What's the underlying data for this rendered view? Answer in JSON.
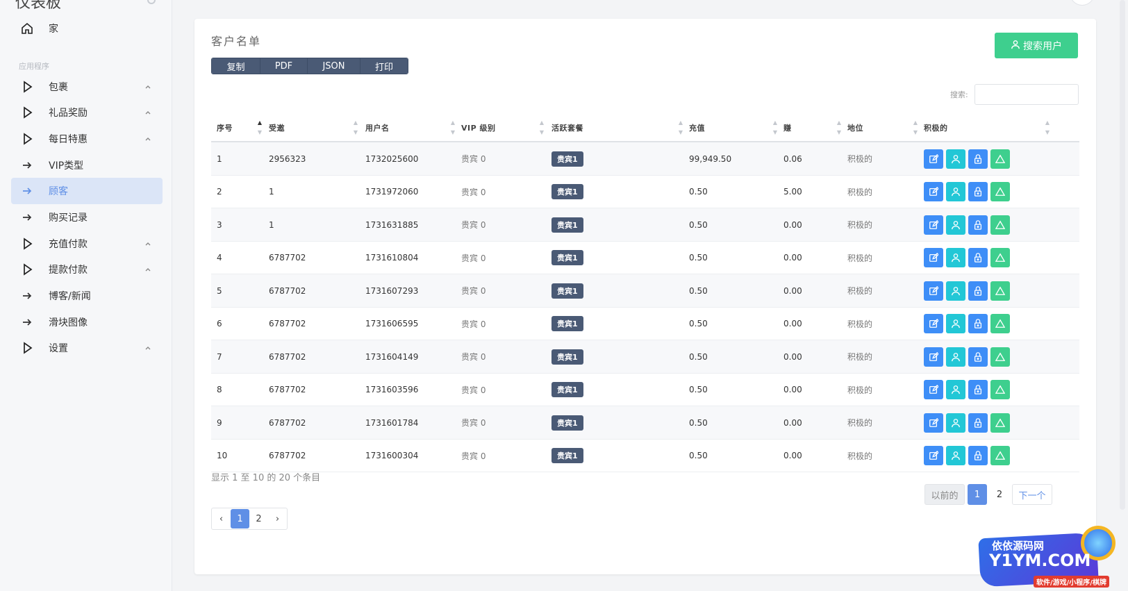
{
  "sidebar": {
    "brand": "仪表板",
    "section_label": "应用程序",
    "items": [
      {
        "label": "家",
        "icon": "home-icon",
        "has_chevron": false
      },
      {
        "label": "包裹",
        "icon": "play-icon",
        "has_chevron": true
      },
      {
        "label": "礼品奖励",
        "icon": "play-icon",
        "has_chevron": true
      },
      {
        "label": "每日特惠",
        "icon": "play-icon",
        "has_chevron": true
      },
      {
        "label": "VIP类型",
        "icon": "arrow-right-icon",
        "has_chevron": false
      },
      {
        "label": "顾客",
        "icon": "arrow-right-icon",
        "has_chevron": false,
        "active": true
      },
      {
        "label": "购买记录",
        "icon": "arrow-right-icon",
        "has_chevron": false
      },
      {
        "label": "充值付款",
        "icon": "play-icon",
        "has_chevron": true
      },
      {
        "label": "提款付款",
        "icon": "play-icon",
        "has_chevron": true
      },
      {
        "label": "博客/新闻",
        "icon": "arrow-right-icon",
        "has_chevron": false
      },
      {
        "label": "滑块图像",
        "icon": "arrow-right-icon",
        "has_chevron": false
      },
      {
        "label": "设置",
        "icon": "play-icon",
        "has_chevron": true
      }
    ]
  },
  "card": {
    "title": "客户名单",
    "search_user_button": "搜索用户",
    "export_buttons": [
      "复制",
      "PDF",
      "JSON",
      "打印"
    ],
    "search_label": "搜索:",
    "search_value": ""
  },
  "table": {
    "columns": [
      "序号",
      "受邀",
      "用户名",
      "VIP 级别",
      "活跃套餐",
      "充值",
      "赚",
      "地位",
      "积极的"
    ],
    "rows": [
      [
        "1",
        "2956323",
        "1732025600",
        "贵宾 0",
        "贵宾1",
        "99,949.50",
        "0.06",
        "积极的"
      ],
      [
        "2",
        "1",
        "1731972060",
        "贵宾 0",
        "贵宾1",
        "0.50",
        "5.00",
        "积极的"
      ],
      [
        "3",
        "1",
        "1731631885",
        "贵宾 0",
        "贵宾1",
        "0.50",
        "0.00",
        "积极的"
      ],
      [
        "4",
        "6787702",
        "1731610804",
        "贵宾 0",
        "贵宾1",
        "0.50",
        "0.00",
        "积极的"
      ],
      [
        "5",
        "6787702",
        "1731607293",
        "贵宾 0",
        "贵宾1",
        "0.50",
        "0.00",
        "积极的"
      ],
      [
        "6",
        "6787702",
        "1731606595",
        "贵宾 0",
        "贵宾1",
        "0.50",
        "0.00",
        "积极的"
      ],
      [
        "7",
        "6787702",
        "1731604149",
        "贵宾 0",
        "贵宾1",
        "0.50",
        "0.00",
        "积极的"
      ],
      [
        "8",
        "6787702",
        "1731603596",
        "贵宾 0",
        "贵宾1",
        "0.50",
        "0.00",
        "积极的"
      ],
      [
        "9",
        "6787702",
        "1731601784",
        "贵宾 0",
        "贵宾1",
        "0.50",
        "0.00",
        "积极的"
      ],
      [
        "10",
        "6787702",
        "1731600304",
        "贵宾 0",
        "贵宾1",
        "0.50",
        "0.00",
        "积极的"
      ]
    ],
    "info": "显示 1 至 10 的 20 个条目"
  },
  "pagination": {
    "prev": "以前的",
    "pages": [
      "1",
      "2"
    ],
    "current": "1",
    "next": "下一个",
    "left_prev": "‹",
    "left_next": "›"
  },
  "watermark": {
    "line1": "依依源码网",
    "line2": "Y1YM.COM",
    "line3": "软件/游戏/小程序/棋牌"
  },
  "colors": {
    "primary": "#5f8fe6",
    "success": "#3ecf8e",
    "info": "#22c7d6",
    "dark_button": "#4a5a75"
  }
}
